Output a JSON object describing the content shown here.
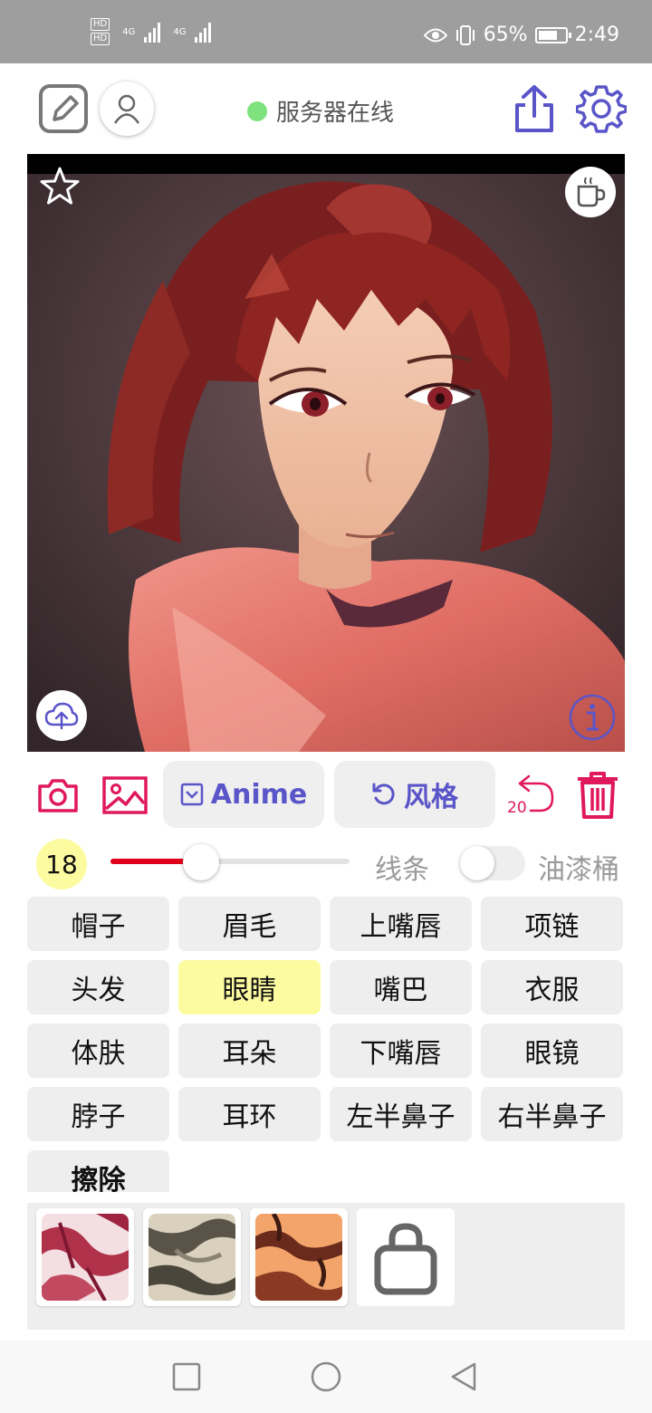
{
  "status_bar": {
    "hd_labels": [
      "HD",
      "HD"
    ],
    "network": [
      "4G",
      "4G"
    ],
    "battery_percent": "65%",
    "time": "2:49",
    "icons": [
      "eye-icon",
      "vibrate-icon",
      "battery-icon"
    ]
  },
  "toolbar": {
    "server_status": "服务器在线",
    "server_status_color": "#7ee27e",
    "icons": [
      "edit-icon",
      "user-icon",
      "share-icon",
      "settings-icon"
    ],
    "accent": "#5a55c8"
  },
  "canvas": {
    "icons": [
      "star-icon",
      "coffee-icon",
      "upload-cloud-icon",
      "info-icon"
    ]
  },
  "actions": {
    "anime_label": "Anime",
    "style_label": "风格",
    "undo_count": "20",
    "icons": [
      "camera-icon",
      "image-icon",
      "checkbox-icon",
      "refresh-icon",
      "undo-icon",
      "trash-icon"
    ],
    "danger_color": "#e0185c"
  },
  "brush": {
    "size": "18",
    "slider_level": 0.38,
    "lines_label": "线条",
    "bucket_label": "油漆桶",
    "bucket_enabled": false
  },
  "parts": {
    "rows": [
      [
        "帽子",
        "眉毛",
        "上嘴唇",
        "项链"
      ],
      [
        "头发",
        "眼睛",
        "嘴巴",
        "衣服"
      ],
      [
        "体肤",
        "耳朵",
        "下嘴唇",
        "眼镜"
      ],
      [
        "脖子",
        "耳环",
        "左半鼻子",
        "右半鼻子"
      ]
    ],
    "erase": "擦除",
    "selected": "眼睛"
  },
  "textures": {
    "icons": [
      "texture-red",
      "texture-beige",
      "texture-orange",
      "shopping-bag-icon"
    ]
  },
  "nav": {
    "icons": [
      "recent-apps-icon",
      "home-icon",
      "back-icon"
    ]
  }
}
